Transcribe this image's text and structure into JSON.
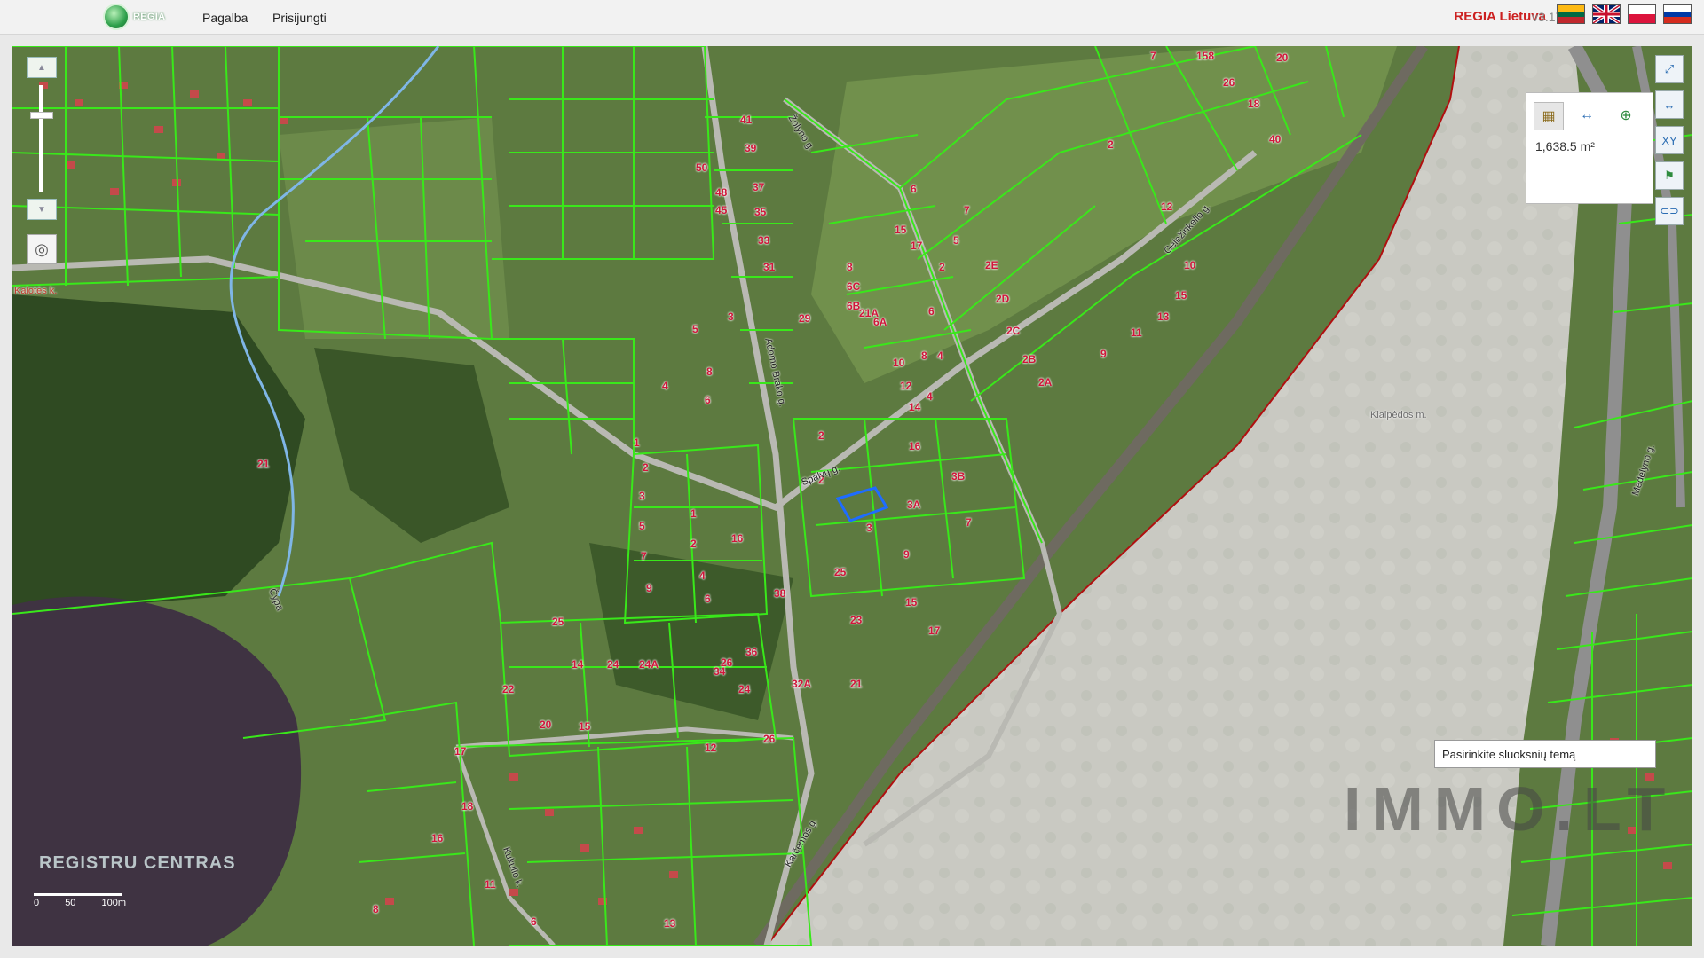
{
  "header": {
    "logo_text": "REGIA",
    "nav": [
      "Pagalba",
      "Prisijungti"
    ],
    "brand": "REGIA Lietuva",
    "version": "v3.17.1",
    "flags": [
      "lithuania-flag",
      "uk-flag",
      "poland-flag",
      "russia-flag"
    ]
  },
  "map": {
    "area_measure": "1,638.5 m²",
    "subject_placeholder": "Pasirinkite sluoksnių temą",
    "scale_labels": [
      "0",
      "50",
      "100m"
    ],
    "logo_text": "REGISTRU CENTRAS",
    "watermark": "IMMO.LT",
    "region_labels": [
      "Kalotės k.",
      "Klaipėdos m."
    ],
    "streets": [
      "Adomo Brako g.",
      "Spalvų g.",
      "Žolyno g.",
      "Geležinkelio g.",
      "Karčemos g.",
      "Medelyno g.",
      "Kukulio k.",
      "Čypa"
    ],
    "parcel_numbers": [
      "41",
      "39",
      "50",
      "48",
      "45",
      "37",
      "35",
      "33",
      "31",
      "29",
      "3",
      "5",
      "8",
      "4",
      "6",
      "2",
      "1",
      "2",
      "3",
      "5",
      "7",
      "9",
      "1",
      "2",
      "4",
      "6",
      "16",
      "38",
      "36",
      "34",
      "32A",
      "21",
      "17",
      "15",
      "23",
      "25",
      "9",
      "7",
      "3A",
      "3B",
      "3",
      "2",
      "16",
      "14",
      "12",
      "10",
      "8",
      "4",
      "6",
      "17",
      "15",
      "8",
      "6C",
      "6B",
      "21A",
      "6A",
      "6",
      "4",
      "2",
      "5",
      "7",
      "2E",
      "2D",
      "2C",
      "2B",
      "2A",
      "2",
      "12",
      "10",
      "15",
      "13",
      "11",
      "9",
      "7",
      "158",
      "26",
      "18",
      "20",
      "40",
      "21",
      "25",
      "22",
      "20",
      "15",
      "17",
      "18",
      "16",
      "14",
      "24",
      "24A",
      "26",
      "24",
      "26",
      "13",
      "12",
      "11",
      "8",
      "6",
      "4",
      "2"
    ]
  }
}
